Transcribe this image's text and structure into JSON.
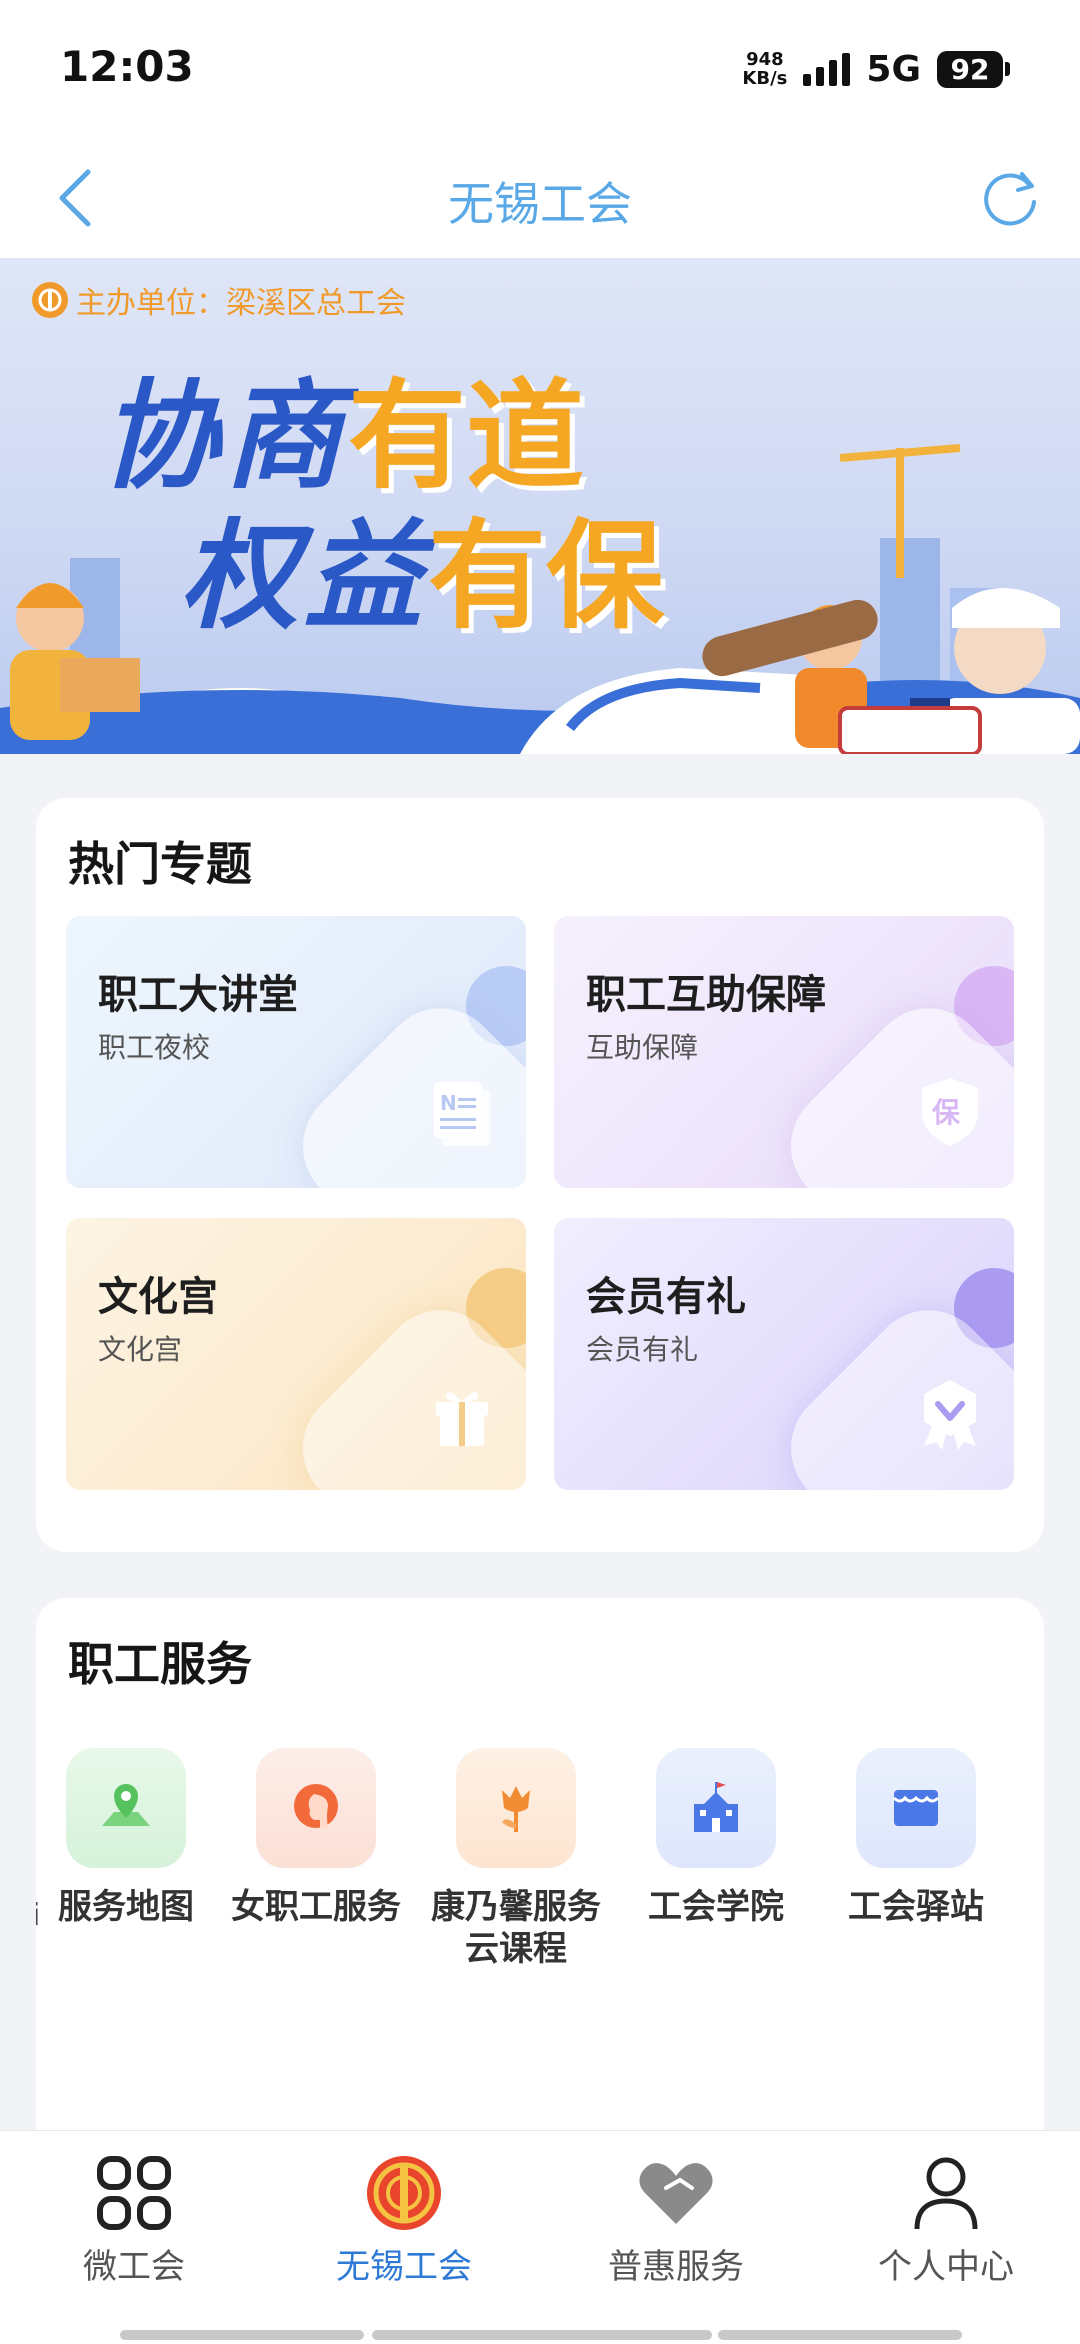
{
  "status_bar": {
    "time": "12:03",
    "net_speed_value": "948",
    "net_speed_unit": "KB/s",
    "network": "5G",
    "battery": "92"
  },
  "header": {
    "title": "无锡工会"
  },
  "banner": {
    "sponsor": "主办单位：梁溪区总工会",
    "line1_calli": "协商",
    "line1_gold": "有道",
    "line2_calli": "权益",
    "line2_gold": "有保"
  },
  "topics": {
    "title": "热门专题",
    "tiles": [
      {
        "title": "职工大讲堂",
        "subtitle": "职工夜校",
        "icon": "newspaper-icon"
      },
      {
        "title": "职工互助保障",
        "subtitle": "互助保障",
        "icon": "shield-icon"
      },
      {
        "title": "文化宫",
        "subtitle": "文化宫",
        "icon": "gift-icon"
      },
      {
        "title": "会员有礼",
        "subtitle": "会员有礼",
        "icon": "badge-icon"
      }
    ]
  },
  "services": {
    "title": "职工服务",
    "partial_left": "i",
    "items": [
      {
        "label": "服务地图",
        "icon": "map-pin-icon"
      },
      {
        "label": "女职工服务",
        "icon": "woman-profile-icon"
      },
      {
        "label": "康乃馨服务云课程",
        "label_line1": "康乃馨服务",
        "label_line2": "云课程",
        "icon": "carnation-icon"
      },
      {
        "label": "工会学院",
        "icon": "school-icon"
      },
      {
        "label": "工会驿站",
        "icon": "station-icon"
      }
    ]
  },
  "bottom_nav": {
    "items": [
      {
        "label": "微工会",
        "icon": "grid-icon"
      },
      {
        "label": "无锡工会",
        "icon": "union-logo-icon",
        "active": true
      },
      {
        "label": "普惠服务",
        "icon": "heart-icon"
      },
      {
        "label": "个人中心",
        "icon": "person-icon"
      }
    ]
  },
  "colors": {
    "accent": "#2e7ad6",
    "header_title": "#5aa9e6",
    "banner_gold": "#f5a623",
    "banner_blue": "#2a58c7"
  }
}
